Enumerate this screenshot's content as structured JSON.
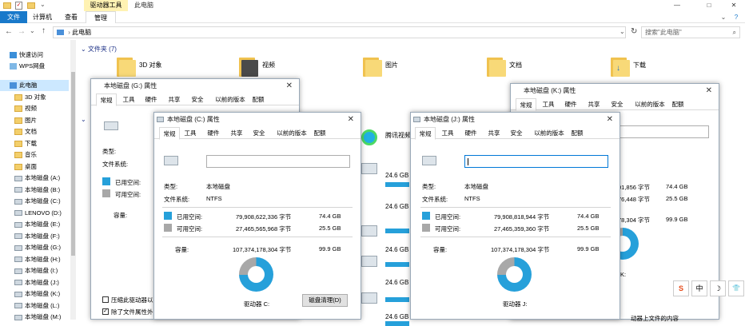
{
  "window": {
    "title": "此电脑",
    "context_tab": "驱动器工具",
    "controls": {
      "minimize": "—",
      "maximize": "□",
      "close": "✕"
    }
  },
  "ribbon": {
    "tabs": [
      "文件",
      "计算机",
      "查看",
      "管理"
    ],
    "help": "?"
  },
  "address": {
    "path": "此电脑",
    "search_placeholder": "搜索\"此电脑\"",
    "back": "←",
    "forward": "→",
    "up": "↑",
    "refresh": "↻",
    "dropdown": "⌄"
  },
  "sidebar": {
    "items": [
      {
        "label": "快速访问",
        "icon": "star-icon"
      },
      {
        "label": "WPS网盘",
        "icon": "cloud-icon"
      },
      {
        "label": "此电脑",
        "icon": "computer-icon"
      },
      {
        "label": "3D 对象",
        "icon": "folder-3d-icon"
      },
      {
        "label": "视频",
        "icon": "video-folder-icon"
      },
      {
        "label": "图片",
        "icon": "picture-folder-icon"
      },
      {
        "label": "文档",
        "icon": "document-folder-icon"
      },
      {
        "label": "下载",
        "icon": "download-folder-icon"
      },
      {
        "label": "音乐",
        "icon": "music-folder-icon"
      },
      {
        "label": "桌面",
        "icon": "desktop-folder-icon"
      },
      {
        "label": "本地磁盘 (A:)",
        "icon": "drive-icon"
      },
      {
        "label": "本地磁盘 (B:)",
        "icon": "drive-icon"
      },
      {
        "label": "本地磁盘 (C:)",
        "icon": "drive-icon"
      },
      {
        "label": "LENOVO (D:)",
        "icon": "drive-icon"
      },
      {
        "label": "本地磁盘 (E:)",
        "icon": "drive-icon"
      },
      {
        "label": "本地磁盘 (F:)",
        "icon": "drive-icon"
      },
      {
        "label": "本地磁盘 (G:)",
        "icon": "drive-icon"
      },
      {
        "label": "本地磁盘 (H:)",
        "icon": "drive-icon"
      },
      {
        "label": "本地磁盘 (I:)",
        "icon": "drive-icon"
      },
      {
        "label": "本地磁盘 (J:)",
        "icon": "drive-icon"
      },
      {
        "label": "本地磁盘 (K:)",
        "icon": "drive-icon"
      },
      {
        "label": "本地磁盘 (L:)",
        "icon": "drive-icon"
      },
      {
        "label": "本地磁盘 (M:)",
        "icon": "drive-icon"
      }
    ]
  },
  "content": {
    "folders_header": "文件夹 (7)",
    "folders": [
      "3D 对象",
      "视频",
      "图片",
      "文档",
      "下载"
    ],
    "app_label": "腾讯视频",
    "drive_free": [
      "24.6 GB",
      "24.6 GB",
      "24.6 GB",
      "24.6 GB",
      "24.6 GB"
    ]
  },
  "dialog_bg": {
    "title": "本地磁盘 (G:) 属性",
    "tabs": [
      "常规",
      "工具",
      "硬件",
      "共享",
      "安全",
      "以前的版本",
      "配额"
    ],
    "type_label": "类型:",
    "fs_label": "文件系统:",
    "used_label": "已用空间:",
    "free_label": "可用空间:",
    "cap_label": "容量:",
    "check1": "压缩此驱动器以",
    "check2": "除了文件属性外"
  },
  "dialog_c": {
    "title": "本地磁盘 (C:) 属性",
    "tabs": [
      "常规",
      "工具",
      "硬件",
      "共享",
      "安全",
      "以前的版本",
      "配额"
    ],
    "type_label": "类型:",
    "type_value": "本地磁盘",
    "fs_label": "文件系统:",
    "fs_value": "NTFS",
    "used_label": "已用空间:",
    "used_bytes": "79,908,622,336 字节",
    "used_gb": "74.4 GB",
    "free_label": "可用空间:",
    "free_bytes": "27,465,565,968 字节",
    "free_gb": "25.5 GB",
    "cap_label": "容量:",
    "cap_bytes": "107,374,178,304 字节",
    "cap_gb": "99.9 GB",
    "drive_label": "驱动器 C:",
    "cleanup": "磁盘清理(D)",
    "used_fraction": 0.745
  },
  "dialog_j": {
    "title": "本地磁盘 (J:) 属性",
    "tabs": [
      "常规",
      "工具",
      "硬件",
      "共享",
      "安全",
      "以前的版本",
      "配额"
    ],
    "type_label": "类型:",
    "type_value": "本地磁盘",
    "fs_label": "文件系统:",
    "fs_value": "NTFS",
    "used_label": "已用空间:",
    "used_bytes": "79,908,818,944 字节",
    "used_gb": "74.4 GB",
    "free_label": "可用空间:",
    "free_bytes": "27,465,359,360 字节",
    "free_gb": "25.5 GB",
    "cap_label": "容量:",
    "cap_bytes": "107,374,178,304 字节",
    "cap_gb": "99.9 GB",
    "drive_label": "驱动器 J:",
    "used_fraction": 0.745
  },
  "dialog_k": {
    "title": "本地磁盘 (K:) 属性",
    "tabs": [
      "常规",
      "工具",
      "硬件",
      "共享",
      "安全",
      "以前的版本",
      "配额"
    ],
    "used_partial": "01,856 字节",
    "used_gb": "74.4 GB",
    "free_partial": "76,448 字节",
    "free_gb": "25.5 GB",
    "cap_partial": "78,304 字节",
    "cap_gb": "99.9 GB",
    "drive_partial": "K:",
    "footer_partial": "动器上文件的内容"
  },
  "ime": {
    "logo": "S",
    "lang": "中",
    "moon": "☽",
    "shirt": "👕"
  },
  "colors": {
    "used": "#26a0da",
    "free": "#a8a8a8",
    "accent": "#0078d7",
    "context_tab": "#fff2b3"
  }
}
